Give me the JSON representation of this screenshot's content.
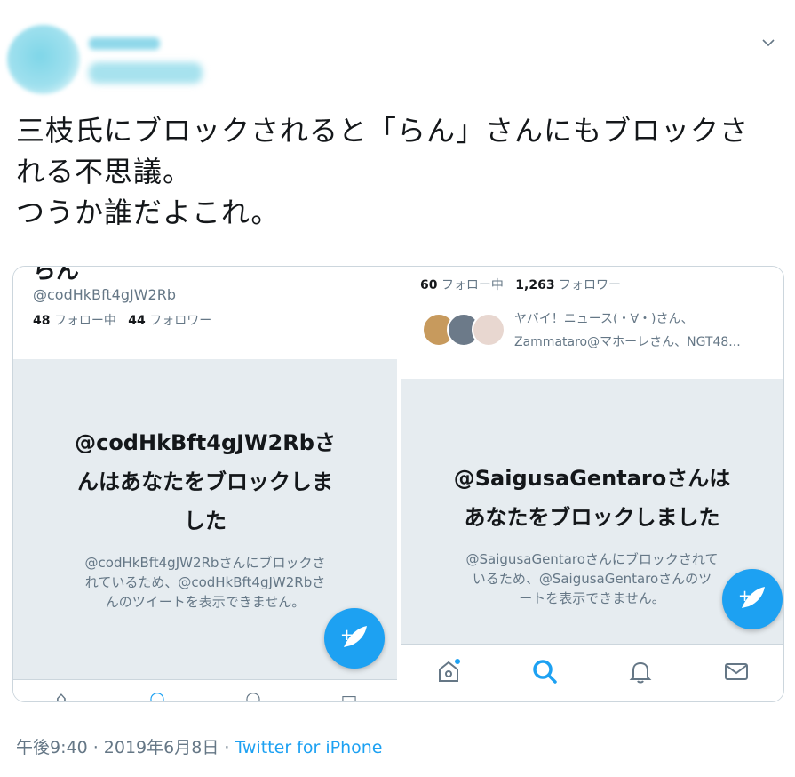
{
  "tweet": {
    "text_lines": [
      "三枝氏にブロックされると「らん」さんにもブロックさ",
      "れる不思議。",
      "つうか誰だよこれ。"
    ],
    "timestamp": "午後9:40 · 2019年6月8日",
    "separator": " · ",
    "source": "Twitter for iPhone"
  },
  "shot_left": {
    "name_cut": "らん",
    "handle": "@codHkBft4gJW2Rb",
    "following_count": "48",
    "following_label": "フォロー中",
    "followers_count": "44",
    "followers_label": "フォロワー",
    "block_title_1": "@codHkBft4gJW2Rbさ",
    "block_title_2": "んはあなたをブロックしま",
    "block_title_3": "した",
    "block_sub_1": "@codHkBft4gJW2Rbさんにブロックさ",
    "block_sub_2": "れているため、@codHkBft4gJW2Rbさ",
    "block_sub_3": "んのツイートを表示できません。"
  },
  "shot_right": {
    "following_count": "60",
    "following_label": "フォロー中",
    "followers_count": "1,263",
    "followers_label": "フォロワー",
    "followed_by_1": "ヤバイ！ニュース(・∀・)さん、",
    "followed_by_2": "Zammataro@マホーレさん、NGT48...",
    "block_title_1": "@SaigusaGentaroさんは",
    "block_title_2": "あなたをブロックしました",
    "block_sub_1": "@SaigusaGentaroさんにブロックされて",
    "block_sub_2": "いるため、@SaigusaGentaroさんのツ",
    "block_sub_3": "ートを表示できません。"
  },
  "icons": {
    "more": "chevron-down-icon",
    "compose": "compose-feather-icon",
    "home": "home-icon",
    "search": "search-icon",
    "notifications": "bell-icon",
    "messages": "mail-icon"
  },
  "colors": {
    "accent": "#1da1f2",
    "muted": "#657786",
    "panel": "#e6ecf0"
  }
}
